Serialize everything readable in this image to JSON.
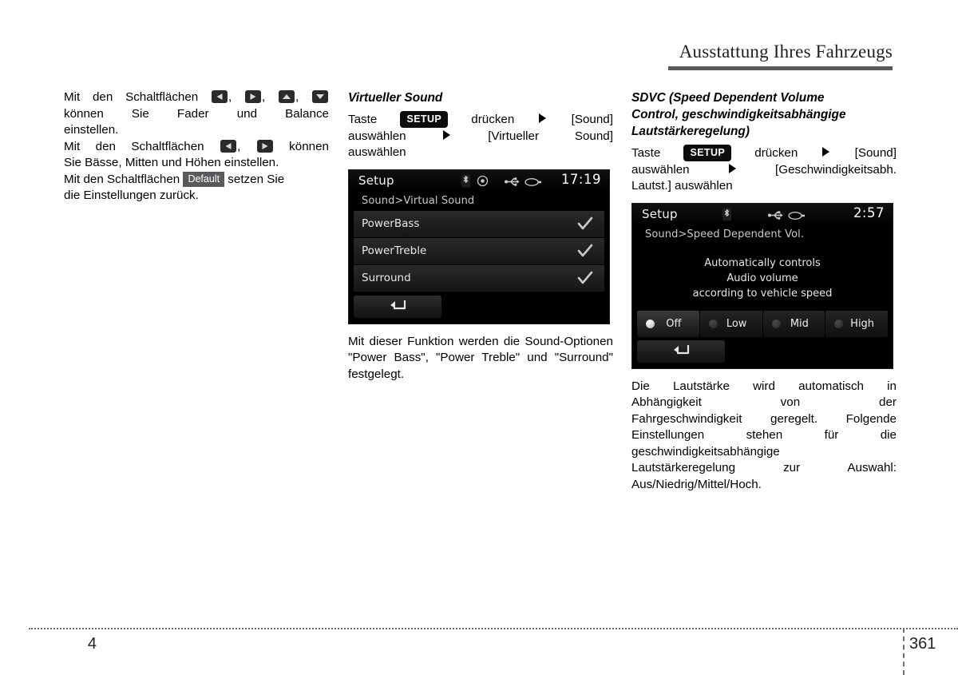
{
  "header": {
    "title": "Ausstattung Ihres Fahrzeugs"
  },
  "footer": {
    "chapter": "4",
    "page": "361"
  },
  "left_column": {
    "paragraph1_part1": "Mit den Schaltflächen",
    "paragraph1_part2": ",",
    "paragraph1_part3": ",",
    "paragraph1_part4": ",",
    "paragraph1_line2": "können Sie Fader und Balance",
    "paragraph1_line3": "einstellen.",
    "paragraph2_part1": "Mit den Schaltflächen",
    "paragraph2_part2": ",",
    "paragraph2_part3": "können",
    "paragraph2_line2": "Sie Bässe, Mitten und Höhen einstellen.",
    "paragraph3_part1": "Mit den Schaltflächen",
    "paragraph3_button": "Default",
    "paragraph3_part2": "setzen Sie",
    "paragraph3_line2": "die Einstellungen zurück."
  },
  "middle_column": {
    "heading": "Virtueller Sound",
    "instruction_part1": "Taste",
    "instruction_button": "SETUP",
    "instruction_part2": "drücken",
    "instruction_part3": "[Sound]",
    "instruction_line2_a": "auswählen",
    "instruction_line2_b": "[Virtueller   Sound]",
    "instruction_line3": "auswählen",
    "device": {
      "title": "Setup",
      "clock": "17:19",
      "breadcrumb": "Sound>Virtual Sound",
      "status_icons": [
        "bluetooth-icon",
        "disc-icon",
        "usb-icon",
        "aux-icon"
      ],
      "rows": [
        {
          "label": "PowerBass",
          "checked": true
        },
        {
          "label": "PowerTreble",
          "checked": true
        },
        {
          "label": "Surround",
          "checked": true
        }
      ],
      "back_button": "back-arrow-icon"
    },
    "caption": "Mit dieser Funktion werden die Sound-Optionen \"Power Bass\", \"Power Treble\" und \"Surround\" festgelegt."
  },
  "right_column": {
    "heading_line1": "SDVC (Speed Dependent Volume",
    "heading_line2": "Control, geschwindigkeitsabhängige",
    "heading_line3": "Lautstärkeregelung)",
    "instruction_part1": "Taste",
    "instruction_button": "SETUP",
    "instruction_part2": "drücken",
    "instruction_part3": "[Sound]",
    "instruction_line2_a": "auswählen",
    "instruction_line2_b": "[Geschwindigkeitsabh.",
    "instruction_line3": "Lautst.] auswählen",
    "device": {
      "title": "Setup",
      "clock": "2:57",
      "breadcrumb": "Sound>Speed Dependent Vol.",
      "status_icons": [
        "bluetooth-icon",
        "usb-icon",
        "aux-icon"
      ],
      "message_line1": "Automatically controls",
      "message_line2": "Audio volume",
      "message_line3": "according to vehicle speed",
      "options": [
        {
          "label": "Off",
          "selected": true
        },
        {
          "label": "Low",
          "selected": false
        },
        {
          "label": "Mid",
          "selected": false
        },
        {
          "label": "High",
          "selected": false
        }
      ],
      "back_button": "back-arrow-icon"
    },
    "body_text": "Die Lautstärke wird automatisch in Abhängigkeit von der Fahrgeschwindigkeit geregelt. Folgende Einstellungen stehen für die geschwindigkeitsabhängige Lautstärkeregelung zur Auswahl: Aus/Niedrig/Mittel/Hoch.",
    "body_line1": "Die Lautstärke wird automatisch in",
    "body_line2": "Abhängigkeit von der",
    "body_line3": "Fahrgeschwindigkeit geregelt. Folgende",
    "body_line4": "Einstellungen stehen für die",
    "body_line5": "geschwindigkeitsabhängige",
    "body_line6": "Lautstärkeregelung zur Auswahl:",
    "body_line7": "Aus/Niedrig/Mittel/Hoch."
  },
  "colors": {
    "header_rule": "#58595b",
    "device_background": "#000000",
    "badge_background": "#0d0d0d",
    "default_badge_background": "#58595b"
  }
}
